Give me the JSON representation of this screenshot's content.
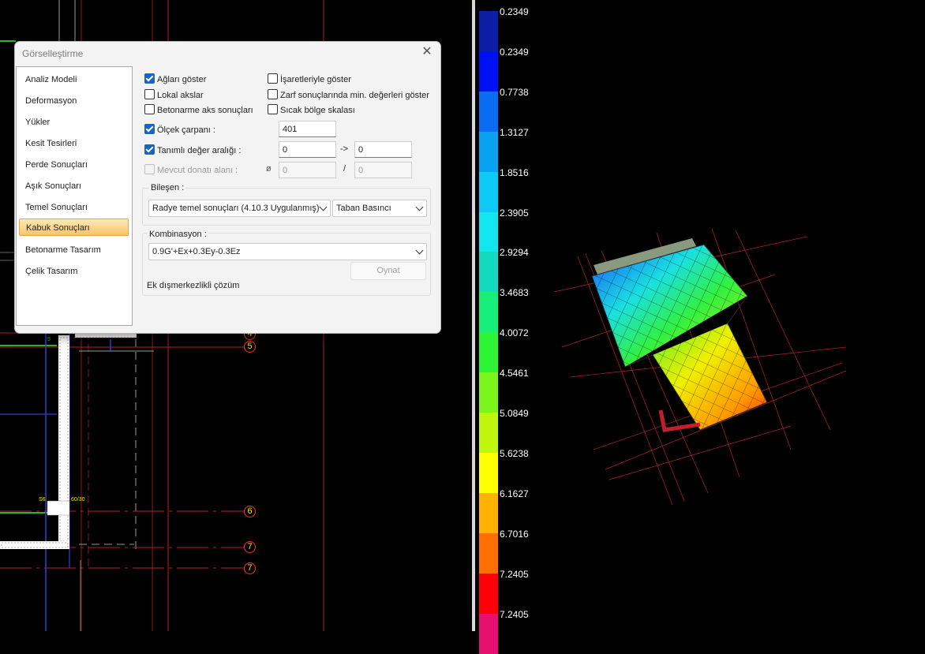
{
  "dialog": {
    "title": "Görselleştirme",
    "nav": [
      {
        "label": "Analiz Modeli"
      },
      {
        "label": "Deformasyon"
      },
      {
        "label": "Yükler"
      },
      {
        "label": "Kesit Tesirleri"
      },
      {
        "label": "Perde Sonuçları"
      },
      {
        "label": "Aşık Sonuçları"
      },
      {
        "label": "Temel Sonuçları"
      },
      {
        "label": "Kabuk Sonuçları",
        "selected": true
      },
      {
        "label": "Betonarme Tasarım"
      },
      {
        "label": "Çelik Tasarım"
      }
    ],
    "options": {
      "show_mesh": {
        "label": "Ağları göster",
        "checked": true
      },
      "local_axes": {
        "label": "Lokal akslar",
        "checked": false
      },
      "rc_axis_results": {
        "label": "Betonarme aks sonuçları",
        "checked": false
      },
      "show_with_signs": {
        "label": "İşaretleriyle göster",
        "checked": false
      },
      "envelope_min": {
        "label": "Zarf sonuçlarında min. değerleri göster",
        "checked": false
      },
      "hot_zone_scale": {
        "label": "Sıcak bölge skalası",
        "checked": false
      },
      "scale_factor": {
        "label": "Ölçek çarpanı :",
        "checked": true,
        "value": "401"
      },
      "defined_range": {
        "label": "Tanımlı değer aralığı :",
        "checked": true,
        "from": "0",
        "arrow": "->",
        "to": "0"
      },
      "existing_rebar": {
        "label": "Mevcut donatı alanı :",
        "checked": false,
        "diameter_symbol": "ø",
        "value1": "0",
        "separator": "/",
        "value2": "0"
      }
    },
    "component": {
      "label": "Bileşen :",
      "type": "Radye temel sonuçları (4.10.3 Uygulanmış)",
      "result": "Taban Basıncı"
    },
    "combination": {
      "label": "Kombinasyon :",
      "value": "0.9G'+Ex+0.3Ey-0.3Ez",
      "play_button": "Oynat",
      "eccentric_note": "Ek dışmerkezlikli çözüm"
    }
  },
  "legend": {
    "values": [
      "0.2349",
      "0.2349",
      "0.7738",
      "1.3127",
      "1.8516",
      "2.3905",
      "2.9294",
      "3.4683",
      "4.0072",
      "4.5461",
      "5.0849",
      "5.6238",
      "6.1627",
      "6.7016",
      "7.2405",
      "7.2405"
    ],
    "colors": [
      "#0a1fa6",
      "#0010f5",
      "#0a6cf2",
      "#08a2f0",
      "#0ccaf5",
      "#14e6f0",
      "#12d9bf",
      "#16f07a",
      "#2ef533",
      "#7cf51a",
      "#c0f50e",
      "#ffff00",
      "#ffb300",
      "#ff6f00",
      "#ff0008",
      "#e8106e"
    ]
  },
  "cad": {
    "axis_markers": [
      "4",
      "5",
      "6",
      "7",
      "7"
    ],
    "labels": [
      "S6",
      "60/30",
      "5"
    ]
  }
}
